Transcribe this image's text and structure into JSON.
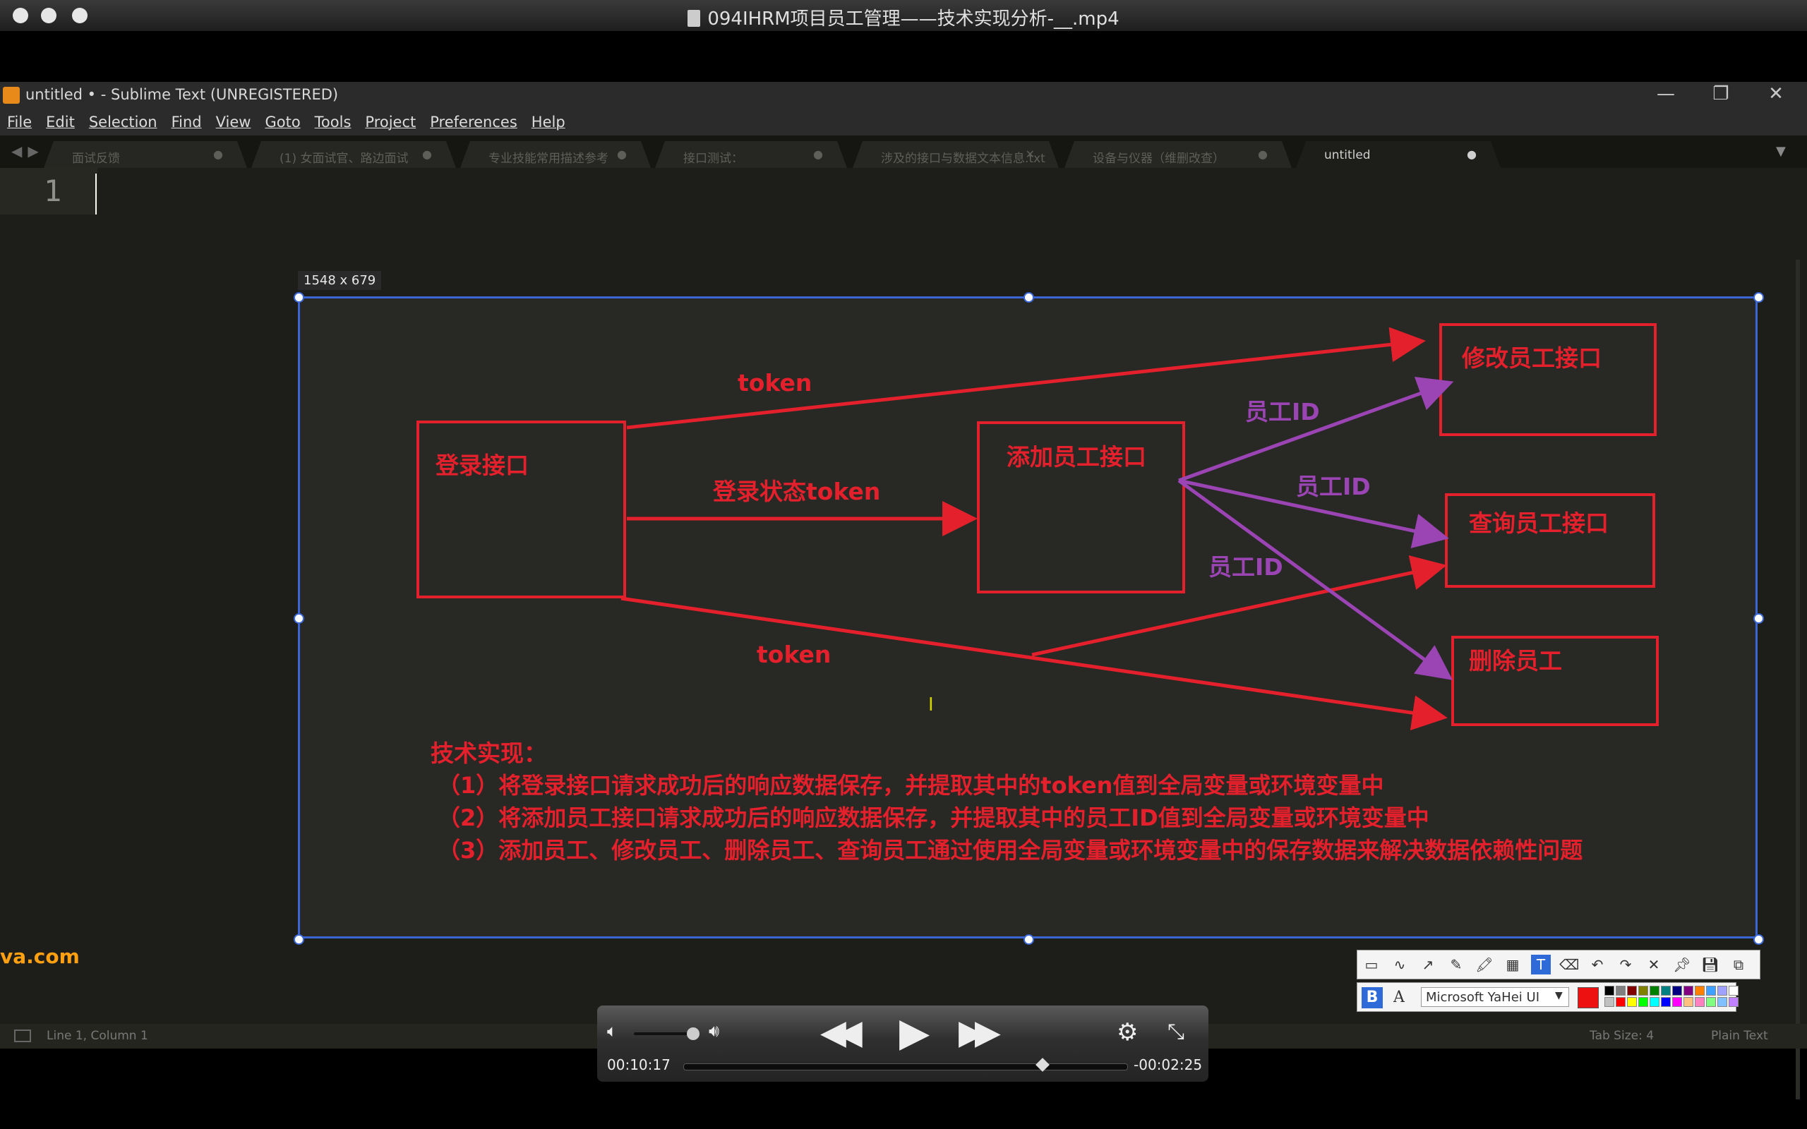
{
  "video": {
    "title": "094IHRM项目员工管理——技术实现分析-__.mp4"
  },
  "sublime": {
    "title": "untitled • - Sublime Text (UNREGISTERED)",
    "menu": [
      "File",
      "Edit",
      "Selection",
      "Find",
      "View",
      "Goto",
      "Tools",
      "Project",
      "Preferences",
      "Help"
    ],
    "tabs": [
      {
        "label": "面试反馈",
        "active": false
      },
      {
        "label": "(1) 女面试官、路边面试",
        "active": false
      },
      {
        "label": "专业技能常用描述参考",
        "active": false
      },
      {
        "label": "接口测试：",
        "active": false
      },
      {
        "label": "涉及的接口与数据文本信息.txt",
        "active": false
      },
      {
        "label": "设备与仪器（维删改查）",
        "active": false
      },
      {
        "label": "untitled",
        "active": true
      }
    ],
    "line_number": "1",
    "watermark": "va.com",
    "status": {
      "position": "Line 1, Column 1",
      "tab_size": "Tab Size: 4",
      "syntax": "Plain Text"
    }
  },
  "capture": {
    "size_label": "1548 x 679",
    "boxes": {
      "login": "登录接口",
      "add": "添加员工接口",
      "modify": "修改员工接口",
      "query": "查询员工接口",
      "delete": "删除员工"
    },
    "labels": {
      "token_top": "token",
      "login_state": "登录状态token",
      "token_bottom": "token",
      "empid_1": "员工ID",
      "empid_2": "员工ID",
      "empid_3": "员工ID"
    },
    "notes": {
      "heading": "技术实现：",
      "lines": [
        "（1）将登录接口请求成功后的响应数据保存，并提取其中的token值到全局变量或环境变量中",
        "（2）将添加员工接口请求成功后的响应数据保存，并提取其中的员工ID值到全局变量或环境变量中",
        "（3）添加员工、修改员工、删除员工、查询员工通过使用全局变量或环境变量中的保存数据来解决数据依赖性问题"
      ]
    },
    "colors": {
      "red": "#e3202b",
      "purple": "#9b44b4",
      "border": "#3b67d6"
    }
  },
  "annotation_toolbar": {
    "tools": [
      "rect-tool-icon",
      "curve-tool-icon",
      "arrow-tool-icon",
      "pencil-tool-icon",
      "marker-tool-icon",
      "mosaic-tool-icon",
      "text-tool-icon",
      "eraser-tool-icon",
      "undo-icon",
      "redo-icon",
      "close-icon",
      "pin-icon",
      "save-icon",
      "copy-icon"
    ],
    "font": "Microsoft YaHei UI",
    "bold": "B",
    "style": "A",
    "palette": [
      "#000000",
      "#808080",
      "#800000",
      "#808000",
      "#008000",
      "#008080",
      "#000080",
      "#800080",
      "#ff8000",
      "#40a0ff",
      "#a0a0ff",
      "#ffffff",
      "#c0c0c0",
      "#ff0000",
      "#ffff00",
      "#00ff00",
      "#00ffff",
      "#0000ff",
      "#ff00ff",
      "#ffc080",
      "#ff80c0",
      "#80ff80",
      "#80c0ff",
      "#c080ff"
    ],
    "current_color": "#ee1111"
  },
  "player": {
    "elapsed": "00:10:17",
    "remaining": "-00:02:25",
    "progress": 0.81,
    "volume": 0.8
  }
}
